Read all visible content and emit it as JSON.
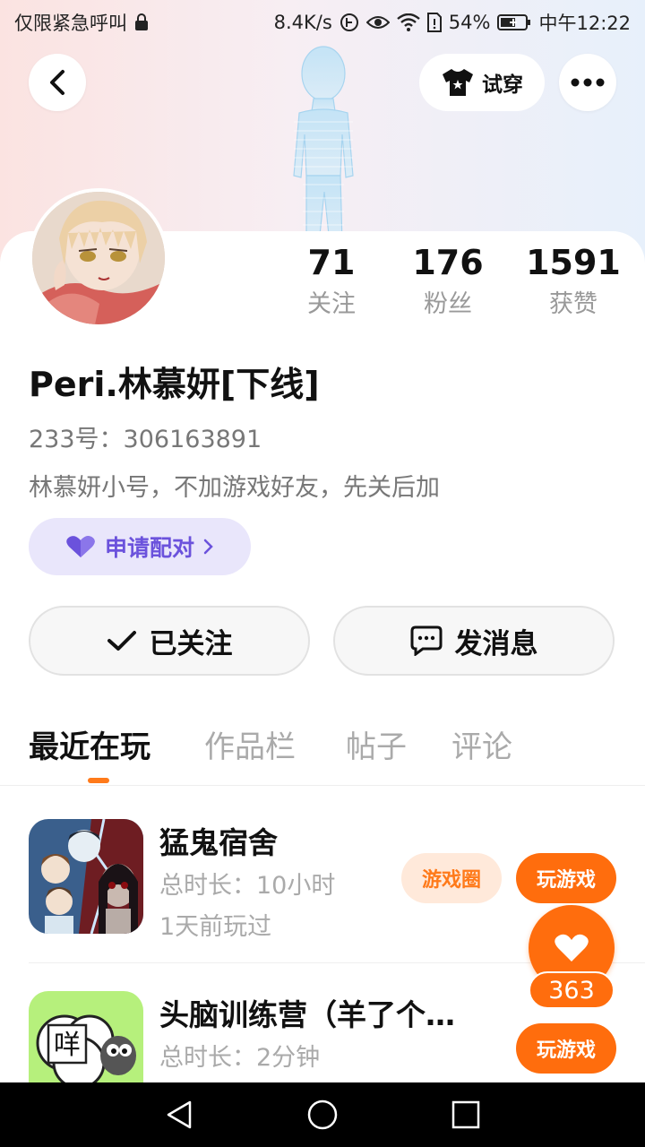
{
  "status_bar": {
    "left_text": "仅限紧急呼叫",
    "net_speed": "8.4K/s",
    "battery": "54%",
    "time": "中午12:22"
  },
  "header": {
    "tryon_label": "试穿"
  },
  "profile": {
    "stats": [
      {
        "value": "71",
        "label": "关注"
      },
      {
        "value": "176",
        "label": "粉丝"
      },
      {
        "value": "1591",
        "label": "获赞"
      }
    ],
    "nickname": "Peri.林慕妍[下线]",
    "uid_label": "233号：",
    "uid_value": "306163891",
    "bio": "林慕妍小号，不加游戏好友，先关后加",
    "pair_label": "申请配对"
  },
  "actions": {
    "follow_label": "已关注",
    "message_label": "发消息"
  },
  "tabs": [
    "最近在玩",
    "作品栏",
    "帖子",
    "评论"
  ],
  "games": [
    {
      "title": "猛鬼宿舍",
      "duration": "总时长：10小时",
      "last_played": "1天前玩过",
      "circle_label": "游戏圈",
      "play_label": "玩游戏"
    },
    {
      "title": "头脑训练营（羊了个…",
      "duration": "总时长：2分钟",
      "play_label": "玩游戏",
      "icon_text": "咩"
    }
  ],
  "like": {
    "count": "363"
  },
  "colors": {
    "accent": "#ff6d0d",
    "pair_purple": "#6b52dc"
  }
}
